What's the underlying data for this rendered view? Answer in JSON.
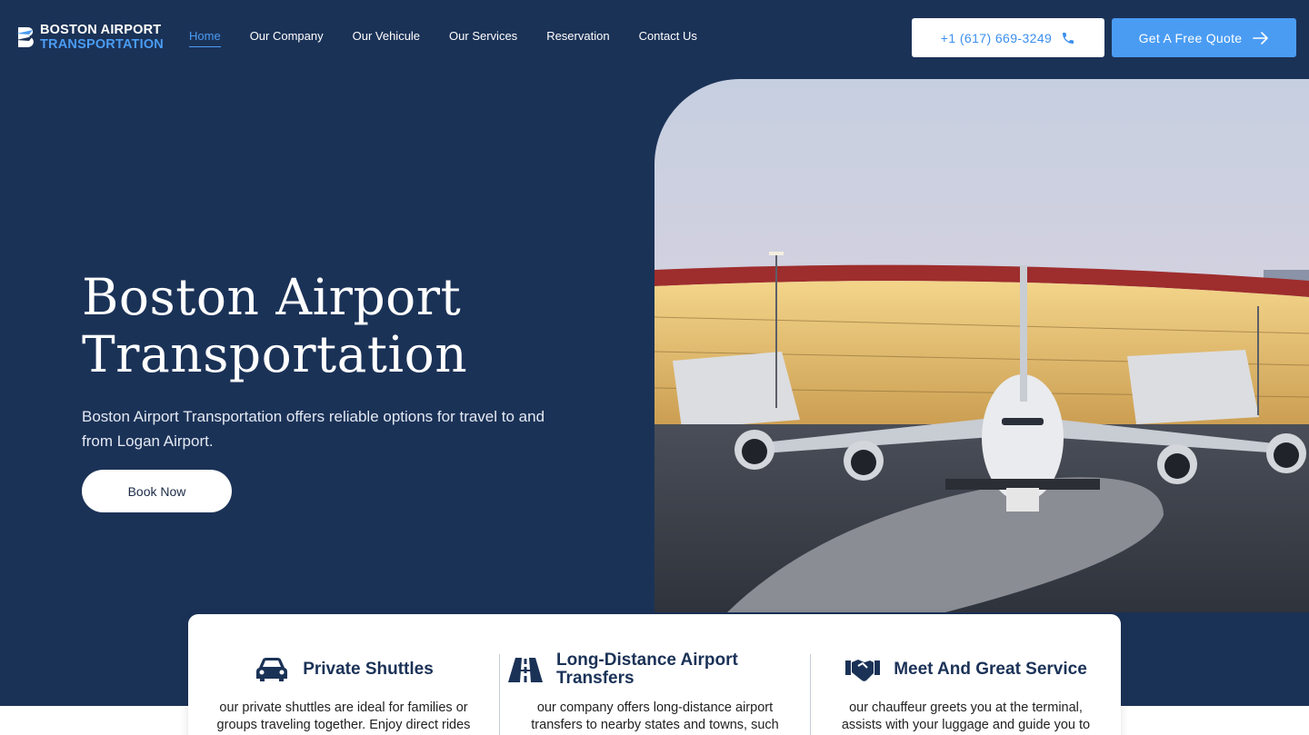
{
  "brand": {
    "line1": "BOSTON AIRPORT",
    "line2": "TRANSPORTATION"
  },
  "nav": {
    "items": [
      {
        "label": "Home",
        "active": true
      },
      {
        "label": "Our Company"
      },
      {
        "label": "Our Vehicule"
      },
      {
        "label": "Our Services"
      },
      {
        "label": "Reservation"
      },
      {
        "label": "Contact Us"
      }
    ]
  },
  "header": {
    "phone": "+1 (617) 669-3249",
    "phone_icon": "phone-icon",
    "quote_label": "Get A Free Quote",
    "quote_icon": "arrow-right-icon"
  },
  "hero": {
    "title_line1": "Boston Airport",
    "title_line2": "Transportation",
    "subtitle": "Boston Airport Transportation offers reliable options for travel to and from Logan Airport.",
    "cta": "Book Now"
  },
  "services": [
    {
      "icon": "car-icon",
      "title": "Private Shuttles",
      "text": "our private shuttles are ideal for families or groups traveling together. Enjoy direct rides"
    },
    {
      "icon": "road-icon",
      "title": "Long-Distance Airport Transfers",
      "text": "our company offers long-distance airport transfers to nearby states and towns, such"
    },
    {
      "icon": "handshake-icon",
      "title": "Meet And Great Service",
      "text": "our chauffeur greets you at the terminal, assists with your luggage and guide you to"
    }
  ],
  "colors": {
    "navy": "#1b3257",
    "accent": "#4a9cf3",
    "white": "#ffffff"
  }
}
